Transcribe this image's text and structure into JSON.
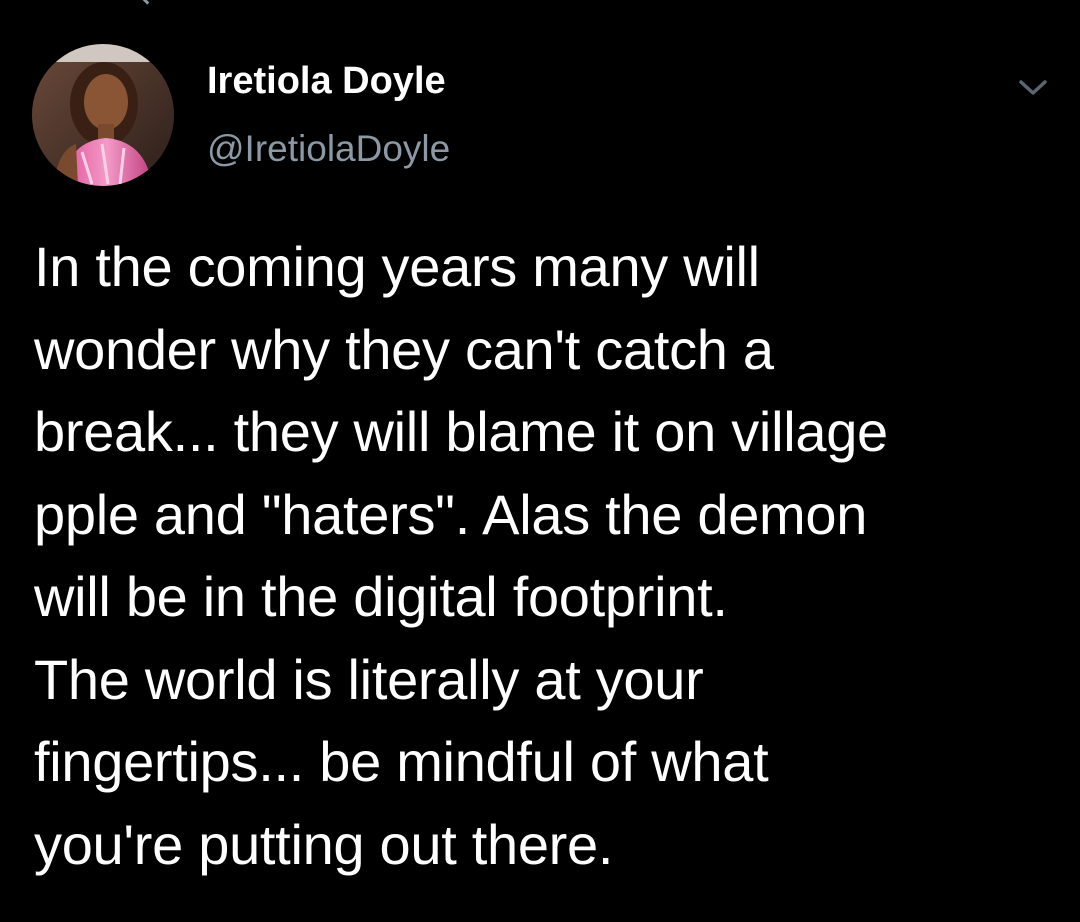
{
  "tweet": {
    "author": {
      "display_name": "Iretiola Doyle",
      "handle": "@IretiolaDoyle",
      "avatar_icon": "profile-photo"
    },
    "menu_icon": "chevron-down-icon",
    "text": "In the coming years many will\nwonder why they can't catch a\nbreak... they will blame it on village\npple and \"haters\". Alas the demon\nwill be in the digital footprint.\nThe world is literally at your\nfingertips... be mindful of what\nyou're putting out there."
  },
  "colors": {
    "background": "#000000",
    "primary_text": "#ffffff",
    "secondary_text": "#8b98a5"
  }
}
